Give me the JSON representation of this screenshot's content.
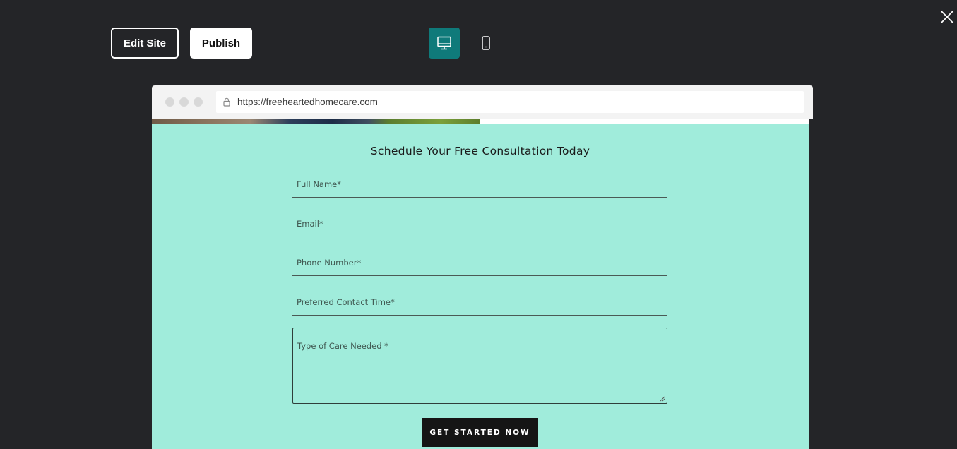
{
  "toolbar": {
    "edit_site_label": "Edit Site",
    "publish_label": "Publish",
    "view_modes": [
      {
        "name": "desktop",
        "icon": "desktop-icon",
        "active": true
      },
      {
        "name": "mobile",
        "icon": "mobile-phone-icon",
        "active": false
      }
    ],
    "close_icon": "close-icon"
  },
  "browser": {
    "url": "https://freeheartedhomecare.com",
    "lock_icon": "lock-icon"
  },
  "form": {
    "title": "Schedule Your Free Consultation Today",
    "fields": [
      {
        "label": "Full Name*"
      },
      {
        "label": "Email*"
      },
      {
        "label": "Phone Number*"
      },
      {
        "label": "Preferred Contact Time*"
      }
    ],
    "textarea_label": "Type of Care Needed *",
    "submit_label": "GET STARTED NOW"
  },
  "colors": {
    "app_background": "#242528",
    "accent": "#0f7a7a",
    "form_background": "#a0ecdb",
    "submit_background": "#151515"
  }
}
